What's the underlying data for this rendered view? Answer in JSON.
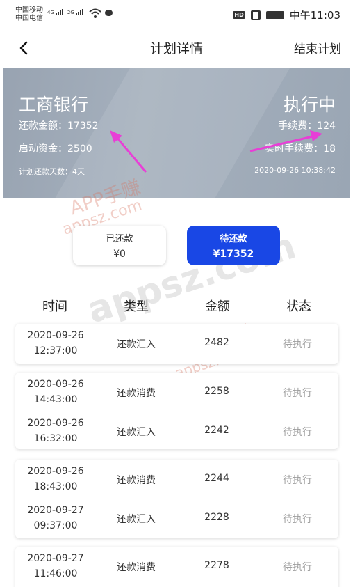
{
  "status_bar": {
    "carrier_1": "中国移动",
    "carrier_2": "中国电信",
    "net_1": "4G",
    "net_2": "2G",
    "hd": "HD",
    "time": "中午11:03"
  },
  "nav": {
    "back_icon": "chevron-left-icon",
    "title": "计划详情",
    "action": "结束计划"
  },
  "summary": {
    "bank": "工商银行",
    "status": "执行中",
    "repay_amount": "还款金额：17352",
    "start_fund": "启动资金：2500",
    "plan_days": "计划还款天数：4天",
    "fee": "手续费：124",
    "realtime_fee": "实时手续费：18",
    "datetime": "2020-09-26 10:38:42",
    "arrow_color": "#e83fd6"
  },
  "cards": {
    "paid_label": "已还款",
    "paid_amount": "¥0",
    "due_label": "待还款",
    "due_amount": "¥17352",
    "due_color": "#1947e5"
  },
  "table": {
    "headers": [
      "时间",
      "类型",
      "金额",
      "状态"
    ],
    "rows": [
      {
        "date": "2020-09-26",
        "time": "12:37:00",
        "type": "还款汇入",
        "amount": "2482",
        "status": "待执行"
      },
      {
        "date": "2020-09-26",
        "time": "14:43:00",
        "type": "还款消费",
        "amount": "2258",
        "status": "待执行"
      },
      {
        "date": "2020-09-26",
        "time": "16:32:00",
        "type": "还款汇入",
        "amount": "2242",
        "status": "待执行"
      },
      {
        "date": "2020-09-26",
        "time": "18:43:00",
        "type": "还款消费",
        "amount": "2244",
        "status": "待执行"
      },
      {
        "date": "2020-09-27",
        "time": "09:37:00",
        "type": "还款汇入",
        "amount": "2228",
        "status": "待执行"
      },
      {
        "date": "2020-09-27",
        "time": "11:46:00",
        "type": "还款消费",
        "amount": "2278",
        "status": "待执行"
      }
    ]
  },
  "watermark": {
    "brand": "APP手赚",
    "domain": "appsz.com"
  }
}
